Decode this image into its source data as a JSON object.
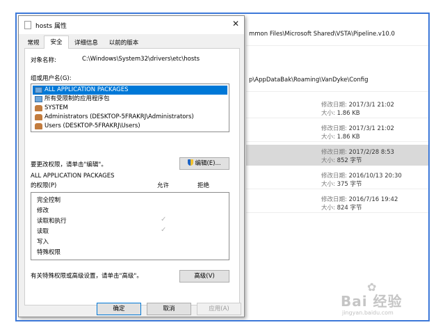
{
  "explorer": {
    "paths": [
      "mmon Files\\Microsoft Shared\\VSTA\\Pipeline.v10.0",
      "p\\AppDataBak\\Roaming\\VanDyke\\Config"
    ],
    "modified_label": "修改日期:",
    "size_label": "大小:",
    "rows": [
      {
        "modified": "2017/3/1 21:02",
        "size": "1.86 KB"
      },
      {
        "modified": "2017/3/1 21:02",
        "size": "1.86 KB"
      },
      {
        "modified": "2017/2/28 8:53",
        "size": "852 字节"
      },
      {
        "modified": "2016/10/13 20:30",
        "size": "375 字节"
      },
      {
        "modified": "2016/7/16 19:42",
        "size": "824 字节"
      }
    ]
  },
  "dialog": {
    "title": "hosts 属性",
    "close_symbol": "✕",
    "tabs": [
      "常规",
      "安全",
      "详细信息",
      "以前的版本"
    ],
    "active_tab": "安全",
    "object_name_label": "对象名称:",
    "object_name_value": "C:\\Windows\\System32\\drivers\\etc\\hosts",
    "group_label": "组或用户名(G):",
    "principals": [
      "ALL APPLICATION PACKAGES",
      "所有受限制的应用程序包",
      "SYSTEM",
      "Administrators (DESKTOP-5FRAKRJ\\Administrators)",
      "Users (DESKTOP-5FRAKRJ\\Users)"
    ],
    "selected_principal": "ALL APPLICATION PACKAGES",
    "edit_hint": "要更改权限，请单击\"编辑\"。",
    "edit_button": "编辑(E)...",
    "perm_for_line1": "ALL APPLICATION PACKAGES",
    "perm_for_line2": "的权限(P)",
    "allow_header": "允许",
    "deny_header": "拒绝",
    "permissions": [
      {
        "name": "完全控制",
        "allow": false
      },
      {
        "name": "修改",
        "allow": false
      },
      {
        "name": "读取和执行",
        "allow": true
      },
      {
        "name": "读取",
        "allow": true
      },
      {
        "name": "写入",
        "allow": false
      },
      {
        "name": "特殊权限",
        "allow": false
      }
    ],
    "check_symbol": "✓",
    "advanced_hint": "有关特殊权限或高级设置，请单击\"高级\"。",
    "advanced_button": "高级(V)",
    "ok_button": "确定",
    "cancel_button": "取消",
    "apply_button": "应用(A)"
  },
  "watermark": {
    "text": "Bai 经验",
    "paw": "✿",
    "url": "jingyan.baidu.com"
  },
  "colors": {
    "frame": "#3c78d8",
    "selection": "#0078d7",
    "selected_row": "#d9d9d9"
  }
}
